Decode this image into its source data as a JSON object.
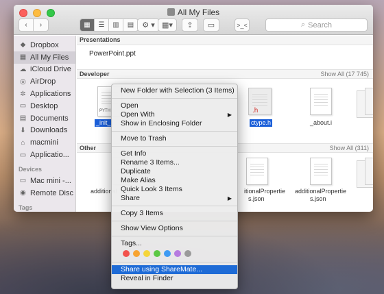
{
  "window": {
    "title": "All My Files"
  },
  "toolbar": {
    "search_placeholder": "Search",
    "gear": "⚙",
    "share": "⇪",
    "tag": "▭",
    "term": ">_<"
  },
  "sidebar": {
    "items": [
      {
        "label": "Dropbox",
        "icon": "dropbox-icon",
        "glyph": "◆"
      },
      {
        "label": "All My Files",
        "icon": "all-files-icon",
        "glyph": "▦"
      },
      {
        "label": "iCloud Drive",
        "icon": "cloud-icon",
        "glyph": "☁"
      },
      {
        "label": "AirDrop",
        "icon": "airdrop-icon",
        "glyph": "◎"
      },
      {
        "label": "Applications",
        "icon": "applications-icon",
        "glyph": "✲"
      },
      {
        "label": "Desktop",
        "icon": "desktop-icon",
        "glyph": "▭"
      },
      {
        "label": "Documents",
        "icon": "documents-icon",
        "glyph": "▤"
      },
      {
        "label": "Downloads",
        "icon": "downloads-icon",
        "glyph": "⬇"
      },
      {
        "label": "macmini",
        "icon": "home-icon",
        "glyph": "⌂"
      },
      {
        "label": "Applicatio...",
        "icon": "folder-icon",
        "glyph": "▭"
      }
    ],
    "devices_header": "Devices",
    "devices": [
      {
        "label": "Mac mini -...",
        "icon": "computer-icon",
        "glyph": "▭"
      },
      {
        "label": "Remote Disc",
        "icon": "disc-icon",
        "glyph": "◉"
      }
    ],
    "tags_header": "Tags"
  },
  "sections": {
    "presentations": {
      "header": "Presentations",
      "file": "PowerPoint.ppt"
    },
    "developer": {
      "header": "Developer",
      "showall": "Show All (17 745)",
      "file_left": "_init_",
      "file_right": "ctype.h",
      "file_about": "_about.i",
      "thumb_ext": ".h",
      "thumb_python": "PYTH"
    },
    "other": {
      "header": "Other",
      "showall": "Show All (311)",
      "file_left_a": "additional",
      "file_left_b": "n",
      "file_mid_a": "itionalPropertie",
      "file_mid_b": "s.json",
      "file_right_a": "additionalPropertie",
      "file_right_b": "s.json"
    }
  },
  "menu": {
    "new_folder": "New Folder with Selection (3 Items)",
    "open": "Open",
    "open_with": "Open With",
    "show_enclosing": "Show in Enclosing Folder",
    "move_trash": "Move to Trash",
    "get_info": "Get Info",
    "rename": "Rename 3 Items...",
    "duplicate": "Duplicate",
    "make_alias": "Make Alias",
    "quick_look": "Quick Look 3 Items",
    "share": "Share",
    "copy": "Copy 3 Items",
    "view_options": "Show View Options",
    "tags": "Tags...",
    "tag_colors": [
      "#f2524d",
      "#f7a431",
      "#f5d53a",
      "#5bc846",
      "#3d9bf3",
      "#b67be0",
      "#9a9a9a"
    ],
    "share_sharemate": "Share using ShareMate...",
    "reveal": "Reveal in Finder",
    "submenu_arrow": "▶"
  }
}
